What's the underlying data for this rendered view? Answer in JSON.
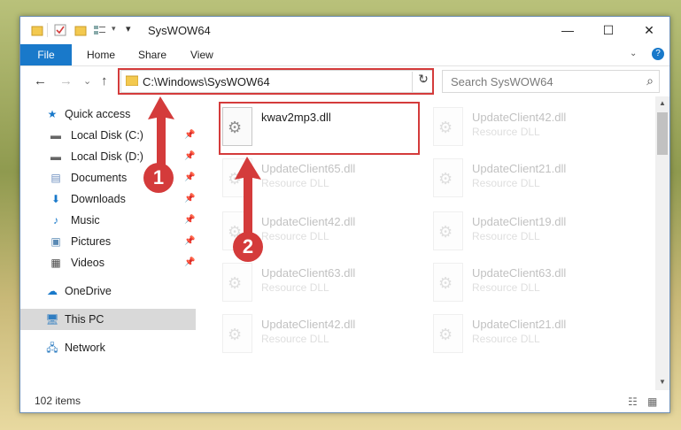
{
  "window": {
    "title": "SysWOW64",
    "minimize": "—",
    "maximize": "☐",
    "close": "✕"
  },
  "ribbon": {
    "file": "File",
    "home": "Home",
    "share": "Share",
    "view": "View",
    "help": "?"
  },
  "nav": {
    "back": "←",
    "forward": "→",
    "recent": "⌄",
    "up": "↑",
    "address": "C:\\Windows\\SysWOW64",
    "search_placeholder": "Search SysWOW64"
  },
  "sidebar": {
    "items": [
      {
        "label": "Quick access",
        "icon": "star-icon",
        "pinned": false
      },
      {
        "label": "Local Disk (C:)",
        "icon": "drive-icon",
        "pinned": true
      },
      {
        "label": "Local Disk (D:)",
        "icon": "drive-icon",
        "pinned": true
      },
      {
        "label": "Documents",
        "icon": "documents-icon",
        "pinned": true
      },
      {
        "label": "Downloads",
        "icon": "downloads-icon",
        "pinned": true
      },
      {
        "label": "Music",
        "icon": "music-icon",
        "pinned": true
      },
      {
        "label": "Pictures",
        "icon": "pictures-icon",
        "pinned": true
      },
      {
        "label": "Videos",
        "icon": "videos-icon",
        "pinned": true
      },
      {
        "label": "OneDrive",
        "icon": "cloud-icon",
        "pinned": false
      },
      {
        "label": "This PC",
        "icon": "computer-icon",
        "pinned": false
      },
      {
        "label": "Network",
        "icon": "network-icon",
        "pinned": false
      }
    ]
  },
  "files": {
    "highlighted": {
      "name": "kwav2mp3.dll",
      "type": ""
    },
    "ghost": [
      {
        "name": "UpdateClient42.dll",
        "type": "Resource DLL"
      },
      {
        "name": "UpdateClient65.dll",
        "type": "Resource DLL"
      },
      {
        "name": "UpdateClient21.dll",
        "type": "Resource DLL"
      },
      {
        "name": "UpdateClient42.dll",
        "type": "Resource DLL"
      },
      {
        "name": "UpdateClient19.dll",
        "type": "Resource DLL"
      },
      {
        "name": "UpdateClient63.dll",
        "type": "Resource DLL"
      },
      {
        "name": "UpdateClient63.dll",
        "type": "Resource DLL"
      },
      {
        "name": "UpdateClient42.dll",
        "type": "Resource DLL"
      },
      {
        "name": "UpdateClient21.dll",
        "type": "Resource DLL"
      }
    ]
  },
  "status": {
    "item_count": "102 items"
  },
  "annotations": {
    "step1": "1",
    "step2": "2",
    "color": "#d43b3b"
  }
}
